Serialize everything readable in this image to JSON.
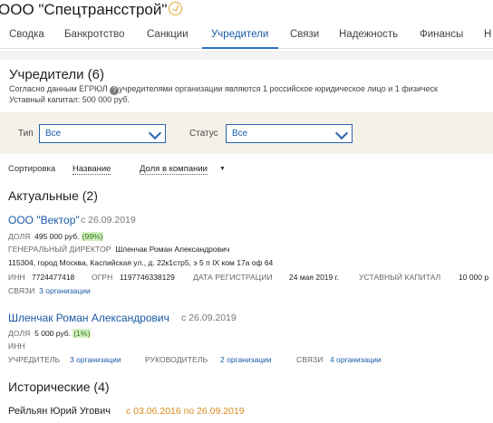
{
  "header": {
    "company_title": "ООО \"Спецтрансстрой\"",
    "star_icon": "star-icon"
  },
  "tabs": [
    {
      "label": "Сводка"
    },
    {
      "label": "Банкротство"
    },
    {
      "label": "Санкции"
    },
    {
      "label": "Учредители",
      "active": true
    },
    {
      "label": "Связи"
    },
    {
      "label": "Надежность"
    },
    {
      "label": "Финансы"
    },
    {
      "label": "Н"
    }
  ],
  "founders": {
    "title": "Учредители (6)",
    "desc_part1": "Согласно данным ЕГРЮЛ",
    "info_icon": "?",
    "desc_part2": "учредителями организации являются 1 российское юридическое лицо и 1 физическ",
    "capital": "Уставный капитал: 500 000 руб."
  },
  "filters": {
    "type_label": "Тип",
    "type_value": "Все",
    "status_label": "Статус",
    "status_value": "Все"
  },
  "sort": {
    "label": "Сортировка",
    "by_name": "Название",
    "by_share": "Доля в компании",
    "caret": "▼"
  },
  "actual": {
    "title": "Актуальные (2)",
    "entities": [
      {
        "name": "ООО \"Вектор\"",
        "since": "с 26.09.2019",
        "share_label": "ДОЛЯ",
        "share_value": "495 000 руб.",
        "share_pct": "(99%)",
        "director_label": "ГЕНЕРАЛЬНЫЙ ДИРЕКТОР",
        "director_value": "Шленчак Роман Александрович",
        "address": "115304, город Москва, Каспийская ул., д. 22к1стр5, э 5 п IX ком 17а оф 64",
        "inn_label": "ИНН",
        "inn_value": "7724477418",
        "ogrn_label": "ОГРН",
        "ogrn_value": "1197746338129",
        "reg_label": "ДАТА РЕГИСТРАЦИИ",
        "reg_value": "24 мая 2019 г.",
        "capital_label": "УСТАВНЫЙ КАПИТАЛ",
        "capital_value": "10 000 р",
        "links_label": "СВЯЗИ",
        "links_value": "3 организации"
      },
      {
        "name": "Шленчак Роман Александрович",
        "since": "с 26.09.2019",
        "share_label": "ДОЛЯ",
        "share_value": "5 000 руб.",
        "share_pct": "(1%)",
        "inn_label": "ИНН",
        "founder_label": "УЧРЕДИТЕЛЬ",
        "founder_value": "3 организации",
        "head_label": "РУКОВОДИТЕЛЬ",
        "head_value": "2 организации",
        "links_label": "СВЯЗИ",
        "links_value": "4 организации"
      }
    ]
  },
  "historic": {
    "title": "Исторические (4)",
    "first_name": "Рейльян Юрий Угович",
    "first_period": "с 03.06.2016 по 26.09.2019"
  }
}
